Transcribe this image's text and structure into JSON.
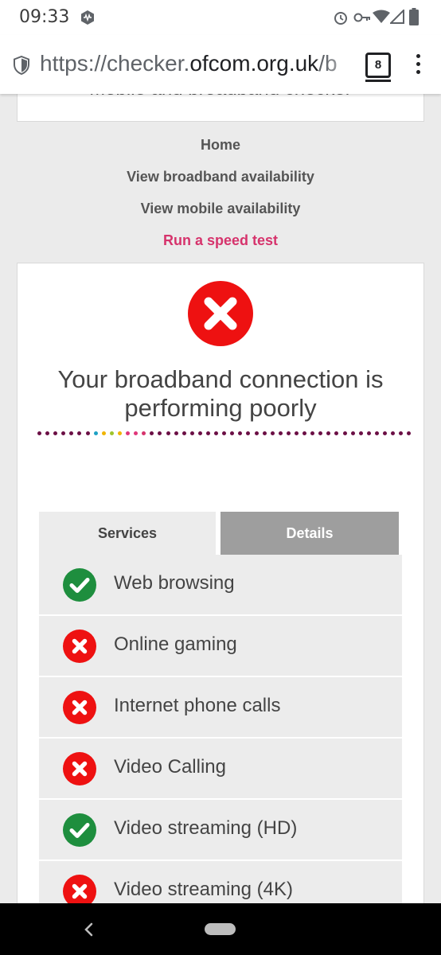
{
  "status_bar": {
    "time": "09:33"
  },
  "browser": {
    "url_prefix": "https://checker.",
    "url_domain": "ofcom.org.uk",
    "url_suffix": "/b",
    "tab_count": "8"
  },
  "page": {
    "top_card_title": "Mobile and broadband checker",
    "nav": {
      "home": "Home",
      "broadband": "View broadband availability",
      "mobile": "View mobile availability",
      "speed_test": "Run a speed test"
    },
    "result": {
      "headline": "Your broadband connection is performing poorly",
      "status_icon": "red-cross-icon"
    },
    "tabs": {
      "services": "Services",
      "details": "Details"
    },
    "services": [
      {
        "label": "Web browsing",
        "status": "ok"
      },
      {
        "label": "Online gaming",
        "status": "fail"
      },
      {
        "label": "Internet phone calls",
        "status": "fail"
      },
      {
        "label": "Video Calling",
        "status": "fail"
      },
      {
        "label": "Video streaming (HD)",
        "status": "ok"
      },
      {
        "label": "Video streaming (4K)",
        "status": "fail"
      }
    ]
  },
  "colors": {
    "accent": "#d6336c",
    "ok": "#1e8e3e",
    "fail": "#ee1111",
    "dot_primary": "#6b0f45"
  }
}
